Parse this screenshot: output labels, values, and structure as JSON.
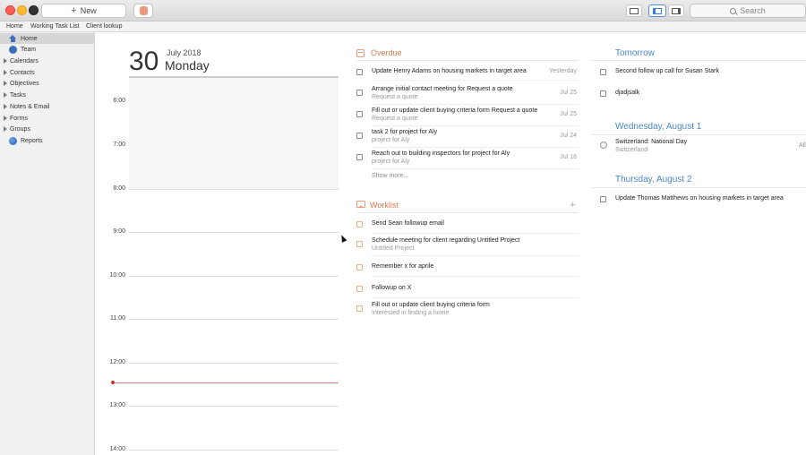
{
  "toolbar": {
    "new_label": "New",
    "search_placeholder": "Search"
  },
  "tabs": [
    "Home",
    "Working Task List",
    "Client lookup"
  ],
  "sidebar": {
    "items": [
      {
        "label": "Home",
        "icon": "home-icon",
        "selected": true,
        "expandable": false
      },
      {
        "label": "Team",
        "icon": "team-icon",
        "selected": false,
        "expandable": false
      },
      {
        "label": "Calendars",
        "expandable": true
      },
      {
        "label": "Contacts",
        "expandable": true
      },
      {
        "label": "Objectives",
        "expandable": true
      },
      {
        "label": "Tasks",
        "expandable": true
      },
      {
        "label": "Notes & Email",
        "expandable": true
      },
      {
        "label": "Forms",
        "expandable": true
      },
      {
        "label": "Groups",
        "expandable": true
      },
      {
        "label": "Reports",
        "icon": "reports-icon",
        "expandable": false
      }
    ]
  },
  "calendar": {
    "day": "30",
    "month_year": "July 2018",
    "weekday": "Monday",
    "hours": [
      "6:00",
      "7:00",
      "8:00",
      "9:00",
      "10:00",
      "11:00",
      "12:00",
      "13:00",
      "14:00"
    ]
  },
  "overdue": {
    "title": "Overdue",
    "tasks": [
      {
        "title": "Update Henry Adams on housing markets in target area",
        "sub": "",
        "date": "Yesterday"
      },
      {
        "title": "Arrange initial contact meeting for Request a quote",
        "sub": "Request a quote",
        "date": "Jul 25"
      },
      {
        "title": "Fill out or update client buying criteria form Request a quote",
        "sub": "Request a quote",
        "date": "Jul 25"
      },
      {
        "title": "task 2 for project for Aly",
        "sub": "project for Aly",
        "date": "Jul 24"
      },
      {
        "title": "Reach out to building inspectors for project for Aly",
        "sub": "project for Aly",
        "date": "Jul 18"
      }
    ],
    "show_more": "Show more..."
  },
  "worklist": {
    "title": "Worklist",
    "tasks": [
      {
        "title": "Send Sean followup email",
        "sub": ""
      },
      {
        "title": "Schedule meeting for client regarding Untitled Project",
        "sub": "Untitled Project"
      },
      {
        "title": "Remember x for aprile",
        "sub": ""
      },
      {
        "title": "Followup on X",
        "sub": ""
      },
      {
        "title": "Fill out or update client buying criteria form",
        "sub": "Interested in finding a home"
      }
    ]
  },
  "upcoming": {
    "tomorrow": {
      "title": "Tomorrow",
      "tasks": [
        {
          "title": "Second follow up call for Susan Stark"
        },
        {
          "title": "djadjsalk"
        }
      ]
    },
    "aug1": {
      "title": "Wednesday, August 1",
      "event_title": "Switzerland: National Day",
      "event_sub": "Switzerland",
      "event_tag": "All"
    },
    "aug2": {
      "title": "Thursday, August 2",
      "tasks": [
        {
          "title": "Update Thomas Matthews on housing markets in target area"
        }
      ]
    }
  }
}
